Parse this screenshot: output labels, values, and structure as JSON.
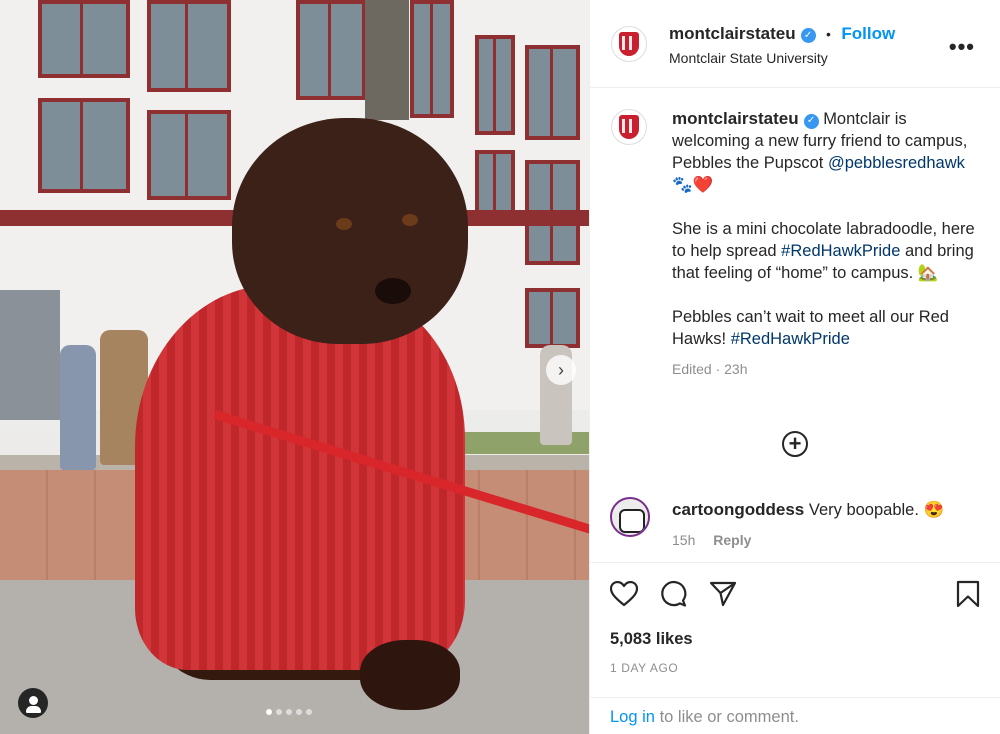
{
  "post": {
    "username": "montclairstateu",
    "verified_icon": "verified-badge-icon",
    "follow_label": "Follow",
    "separator": "•",
    "display_name": "Montclair State University",
    "more_icon": "more-options-icon",
    "more_label": "•••"
  },
  "caption": {
    "text_1": "Montclair is welcoming a new furry friend to campus, Pebbles the Pupscot",
    "mention": "@pebblesredhawk",
    "emoji_1": "🐾❤️",
    "text_2": "She is a mini chocolate labradoodle, here to help spread",
    "hashtag_1": "#RedHawkPride",
    "text_3": "and bring that feeling of “home” to campus.",
    "emoji_2": "🏡",
    "text_4": "Pebbles can’t wait to meet all our Red Hawks!",
    "hashtag_2": "#RedHawkPride",
    "edited": "Edited · 23h"
  },
  "load_more": {
    "icon": "plus-circle-icon",
    "label": "+"
  },
  "comment": {
    "username": "cartoongoddess",
    "text": "Very boopable.",
    "emoji": "😍",
    "time": "15h",
    "reply_label": "Reply"
  },
  "actions": {
    "like_icon": "heart-icon",
    "comment_icon": "comment-icon",
    "share_icon": "share-icon",
    "save_icon": "bookmark-icon"
  },
  "likes": "5,083 likes",
  "date": "1 DAY AGO",
  "login": {
    "link": "Log in",
    "text": "to like or comment."
  },
  "carousel": {
    "next_label": "›",
    "dots_total": 5,
    "active_index": 1
  },
  "colors": {
    "accent": "#0095f6",
    "link": "#00376b",
    "brand_red": "#c8202f"
  }
}
